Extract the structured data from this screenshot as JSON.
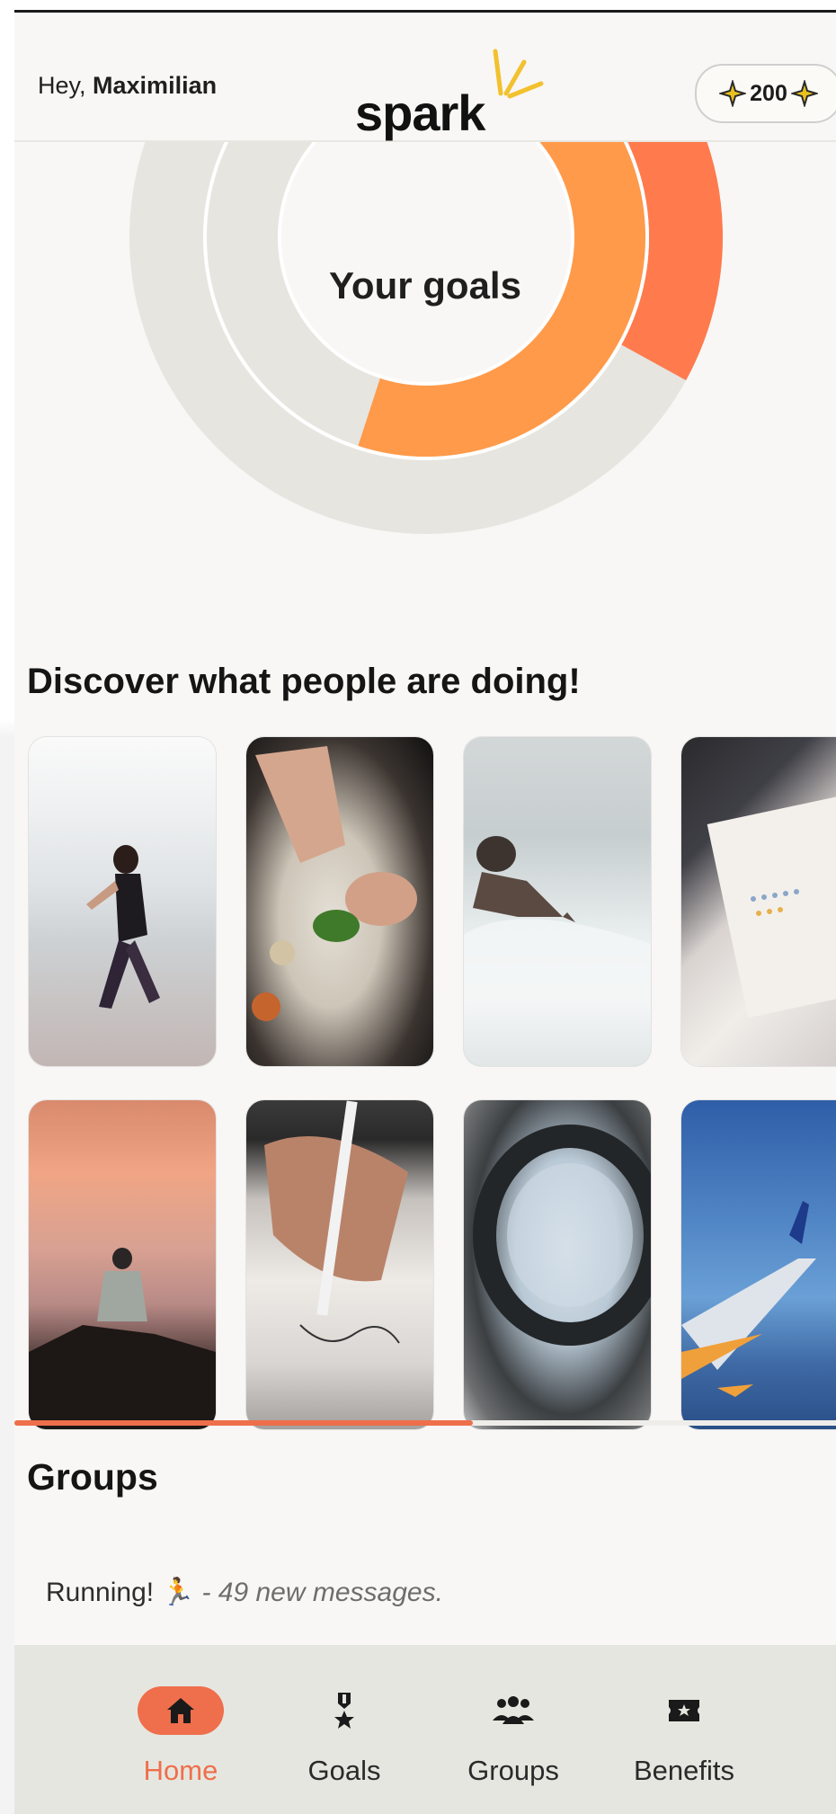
{
  "header": {
    "greeting_prefix": "Hey,",
    "user_name": "Maximilian",
    "logo_text": "spark",
    "points": "200"
  },
  "goals": {
    "label": "Your goals",
    "rings": [
      {
        "name": "outer",
        "progress": 0.33,
        "color": "#ff7a4d"
      },
      {
        "name": "inner",
        "progress": 0.55,
        "color": "#ff9a4a"
      }
    ],
    "track_color": "#e6e5e0"
  },
  "discover": {
    "title": "Discover what people are doing!",
    "tiles": [
      {
        "name": "running"
      },
      {
        "name": "cooking"
      },
      {
        "name": "surfing"
      },
      {
        "name": "planning"
      },
      {
        "name": "meditation"
      },
      {
        "name": "drawing"
      },
      {
        "name": "bowl"
      },
      {
        "name": "travel"
      }
    ]
  },
  "groups": {
    "title": "Groups",
    "items": [
      {
        "name": "Running!",
        "emoji": "🏃",
        "message": "- 49 new messages."
      }
    ]
  },
  "nav": {
    "items": [
      {
        "label": "Home",
        "icon": "home-icon",
        "active": true
      },
      {
        "label": "Goals",
        "icon": "medal-icon",
        "active": false
      },
      {
        "label": "Groups",
        "icon": "group-icon",
        "active": false
      },
      {
        "label": "Benefits",
        "icon": "ticket-icon",
        "active": false
      }
    ]
  },
  "colors": {
    "accent": "#ee6f4b",
    "background": "#f8f7f5",
    "nav_background": "#e6e6e0"
  }
}
